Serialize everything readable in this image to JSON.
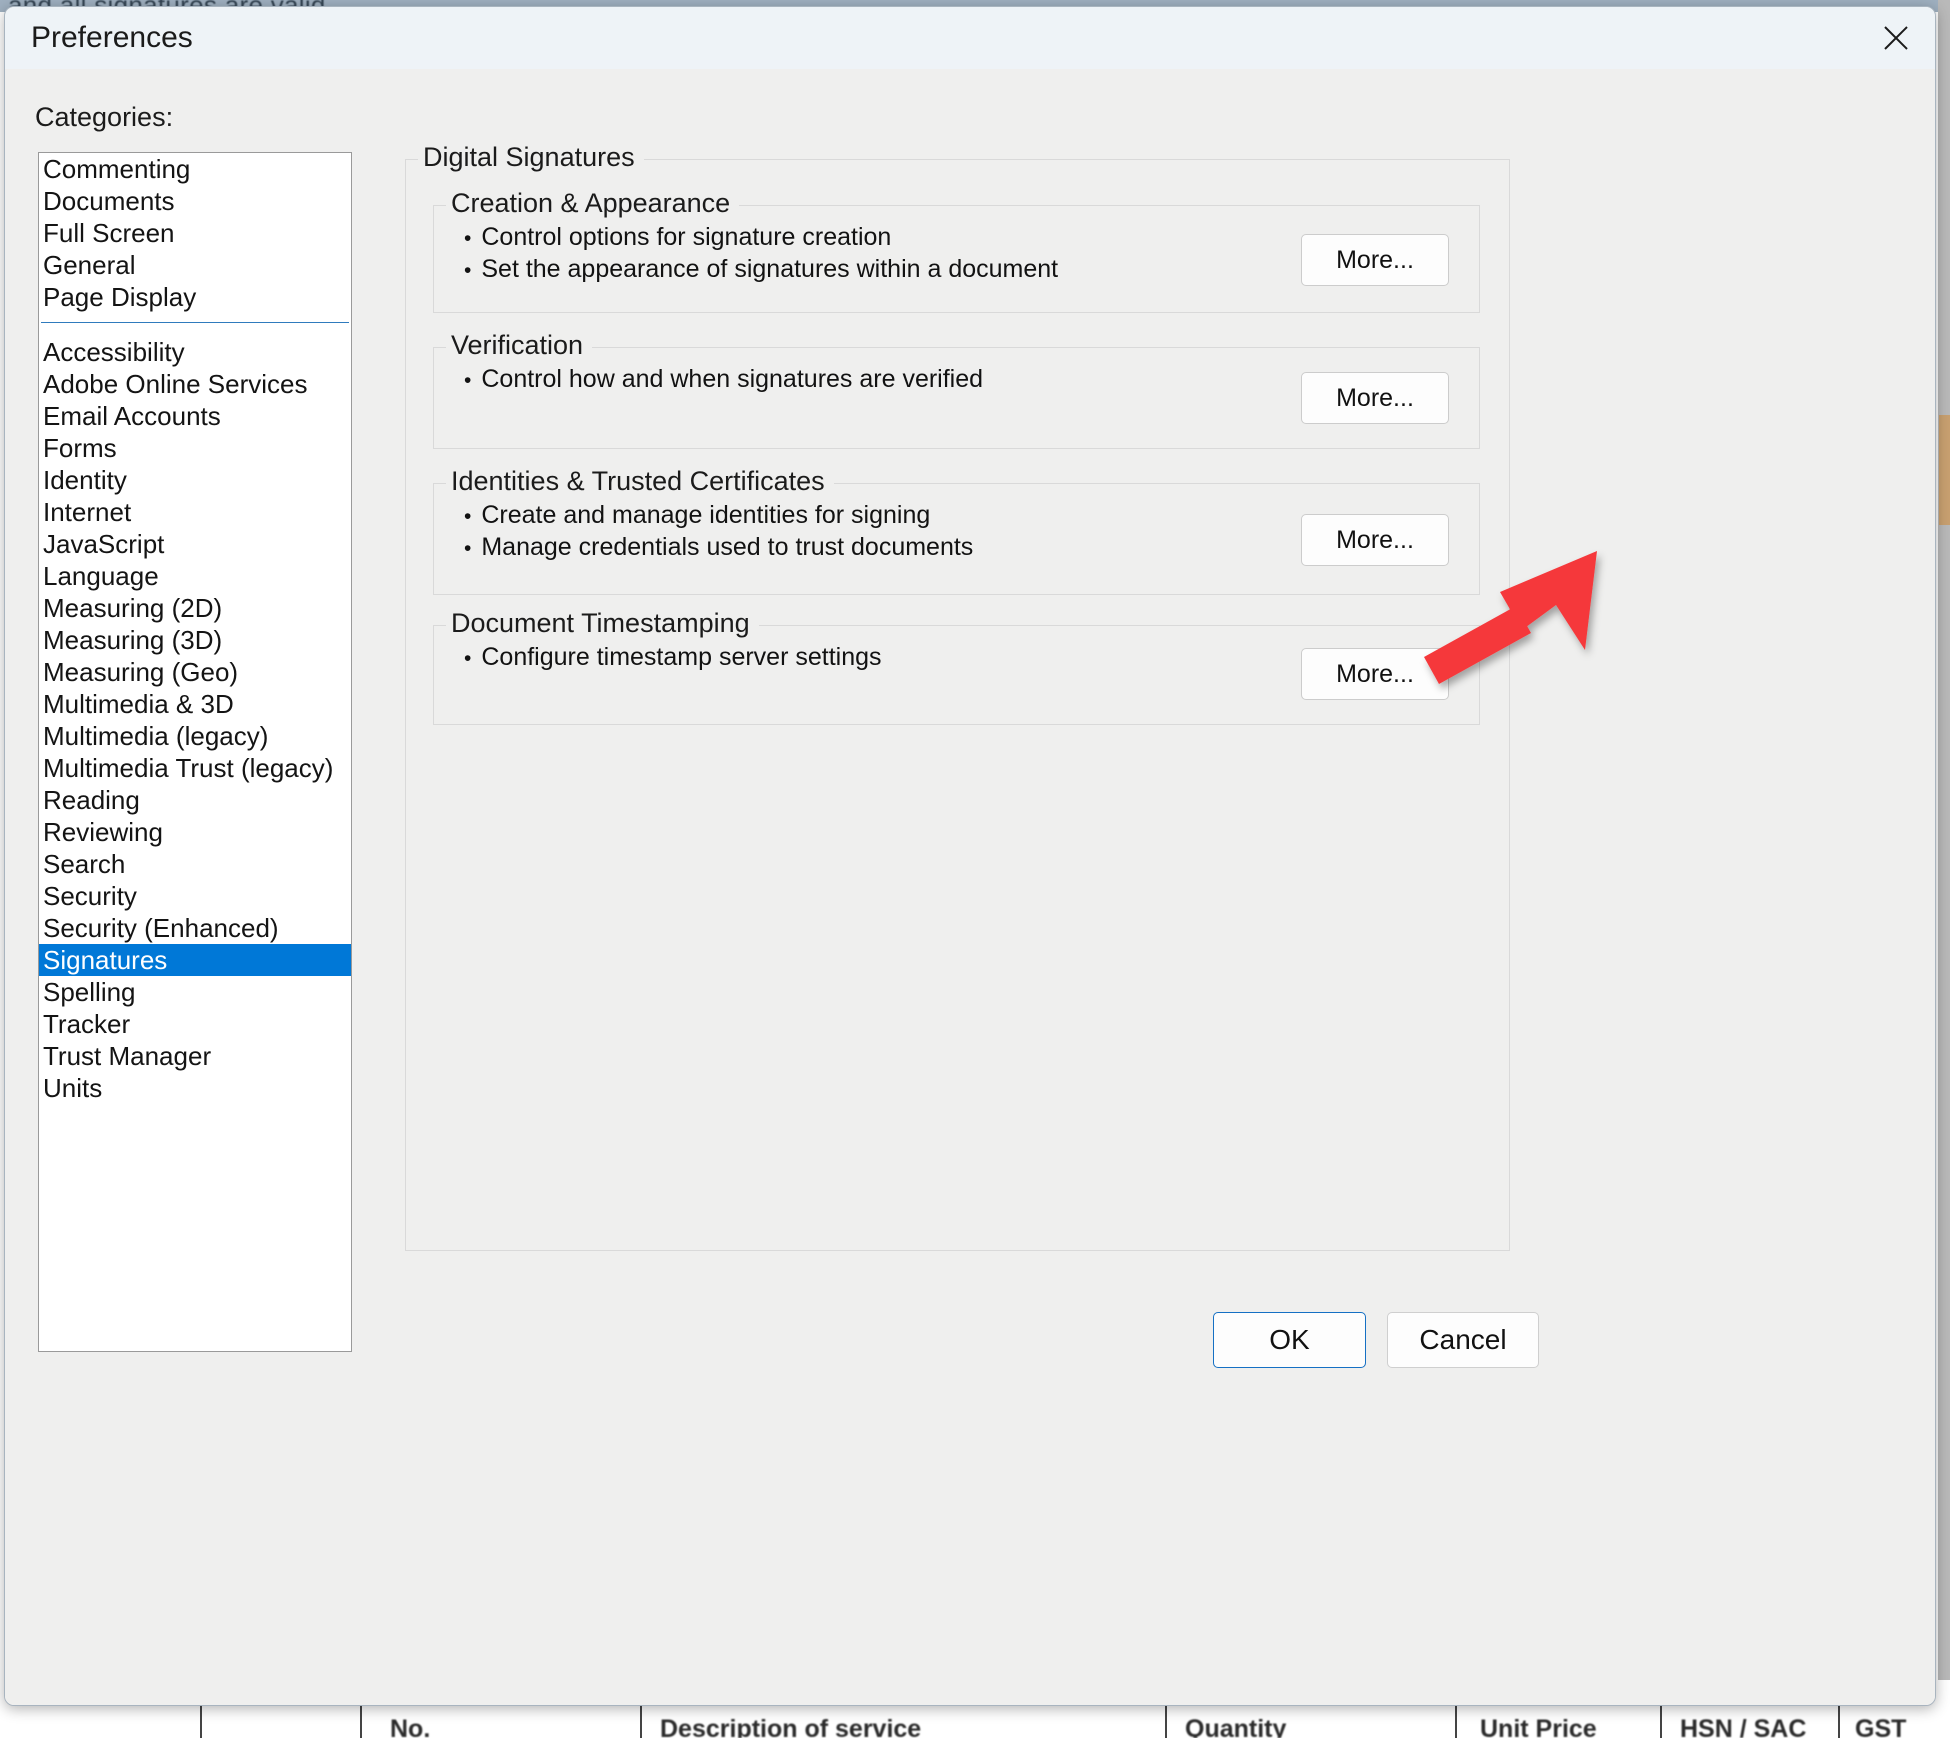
{
  "window": {
    "title": "Preferences",
    "close_icon": "close-icon"
  },
  "background": {
    "top_text": "and all signatures are valid.",
    "table_headers": [
      "No.",
      "Description of service",
      "Quantity",
      "Unit Price",
      "HSN / SAC",
      "GST"
    ]
  },
  "categories": {
    "label": "Categories:",
    "group1": [
      "Commenting",
      "Documents",
      "Full Screen",
      "General",
      "Page Display"
    ],
    "group2": [
      "Accessibility",
      "Adobe Online Services",
      "Email Accounts",
      "Forms",
      "Identity",
      "Internet",
      "JavaScript",
      "Language",
      "Measuring (2D)",
      "Measuring (3D)",
      "Measuring (Geo)",
      "Multimedia & 3D",
      "Multimedia (legacy)",
      "Multimedia Trust (legacy)",
      "Reading",
      "Reviewing",
      "Search",
      "Security",
      "Security (Enhanced)",
      "Signatures",
      "Spelling",
      "Tracker",
      "Trust Manager",
      "Units"
    ],
    "selected": "Signatures",
    "selected_color": "#0078d7",
    "separator_color": "#2f7bbd"
  },
  "panel": {
    "title": "Digital Signatures",
    "sections": [
      {
        "legend": "Creation & Appearance",
        "bullets": [
          "Control options for signature creation",
          "Set the appearance of signatures within a document"
        ],
        "button": "More..."
      },
      {
        "legend": "Verification",
        "bullets": [
          "Control how and when signatures are verified"
        ],
        "button": "More..."
      },
      {
        "legend": "Identities & Trusted Certificates",
        "bullets": [
          "Create and manage identities for signing",
          "Manage credentials used to trust documents"
        ],
        "button": "More..."
      },
      {
        "legend": "Document Timestamping",
        "bullets": [
          "Configure timestamp server settings"
        ],
        "button": "More..."
      }
    ]
  },
  "footer": {
    "ok_label": "OK",
    "cancel_label": "Cancel"
  },
  "annotation": {
    "arrow_color": "#f5383b",
    "points_to": "Identities & Trusted Certificates More... button"
  }
}
